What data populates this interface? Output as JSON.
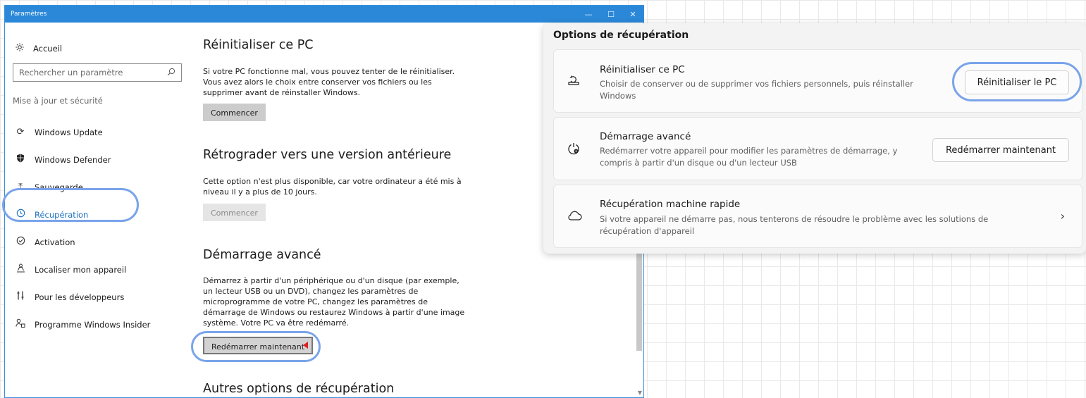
{
  "win10": {
    "title": "Paramètres",
    "controls": {
      "minimize": "—",
      "maximize": "☐",
      "close": "✕"
    },
    "home": {
      "icon": "gear-icon",
      "label": "Accueil"
    },
    "search": {
      "placeholder": "Rechercher un paramètre",
      "icon": "search-icon"
    },
    "section_label": "Mise à jour et sécurité",
    "nav": [
      {
        "label": "Windows Update",
        "icon": "refresh-icon"
      },
      {
        "label": "Windows Defender",
        "icon": "shield-icon"
      },
      {
        "label": "Sauvegarde",
        "icon": "upload-icon"
      },
      {
        "label": "Récupération",
        "icon": "history-icon",
        "active": true
      },
      {
        "label": "Activation",
        "icon": "check-circle-icon"
      },
      {
        "label": "Localiser mon appareil",
        "icon": "person-location-icon"
      },
      {
        "label": "Pour les développeurs",
        "icon": "developer-tools-icon"
      },
      {
        "label": "Programme Windows Insider",
        "icon": "insider-icon"
      }
    ],
    "reset": {
      "title": "Réinitialiser ce PC",
      "text": "Si votre PC fonctionne mal, vous pouvez tenter de le réinitialiser. Vous avez alors le choix entre conserver vos fichiers ou les supprimer avant de réinstaller Windows.",
      "button": "Commencer"
    },
    "rollback": {
      "title": "Rétrograder vers une version antérieure",
      "text": "Cette option n'est plus disponible, car votre ordinateur a été mis à niveau il y a plus de 10 jours.",
      "button": "Commencer"
    },
    "advanced": {
      "title": "Démarrage avancé",
      "text": "Démarrez à partir d'un périphérique ou d'un disque (par exemple, un lecteur USB ou un DVD), changez les paramètres de microprogramme de votre PC, changez les paramètres de démarrage de Windows ou restaurez Windows à partir d'une image système. Votre PC va être redémarré.",
      "button": "Redémarrer maintenant"
    },
    "other": {
      "title": "Autres options de récupération"
    }
  },
  "win11": {
    "title": "Options de récupération",
    "cards": [
      {
        "icon": "reset-pc-icon",
        "title": "Réinitialiser ce PC",
        "desc": "Choisir de conserver ou de supprimer vos fichiers personnels, puis réinstaller Windows",
        "button": "Réinitialiser le PC"
      },
      {
        "icon": "advanced-startup-icon",
        "title": "Démarrage avancé",
        "desc": "Redémarrer votre appareil pour modifier les paramètres de démarrage, y compris à partir d'un disque ou d'un lecteur USB",
        "button": "Redémarrer maintenant"
      },
      {
        "icon": "cloud-icon",
        "title": "Récupération machine rapide",
        "desc": "Si votre appareil ne démarre pas, nous tenterons de résoudre le problème avec les solutions de récupération d'appareil",
        "chevron": "›"
      }
    ]
  },
  "colors": {
    "accent": "#2b88d8",
    "highlight_ring": "#7aa4ea",
    "marker": "#e02020"
  }
}
